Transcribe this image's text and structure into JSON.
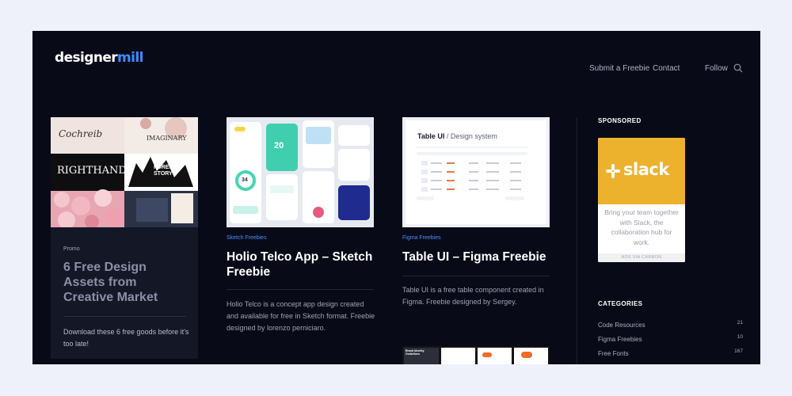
{
  "header": {
    "logo_main": "designer",
    "logo_accent": "mill",
    "nav": [
      "Submit a Freebie",
      "Contact",
      "Follow"
    ]
  },
  "promo": {
    "tag": "Promo",
    "title": "6 Free Design Assets from Creative Market",
    "description": "Download these 6 free goods before it's too late!",
    "thumb_texts": [
      "Cochreib",
      "IMAGINARY",
      "RIGHTHAND",
      "FOREST STORY"
    ]
  },
  "posts": [
    {
      "category": "Sketch Freebies",
      "title": "Holio Telco App – Sketch Freebie",
      "description": "Holio Telco is a concept app design created and available for free in Sketch format. Freebie designed by lorenzo perniciaro.",
      "thumb_numbers": [
        "20",
        "34"
      ]
    },
    {
      "category": "Figma Freebies",
      "title": "Table UI – Figma Freebie",
      "description": "Table UI is a free table component created in Figma. Freebie designed by Sergey.",
      "thumb_title": "Table UI",
      "thumb_subtitle": "/ Design system",
      "next_thumb_text": "Brand Identity Guidelines"
    }
  ],
  "sidebar": {
    "sponsored_heading": "SPONSORED",
    "ad_brand": "slack",
    "ad_text": "Bring your team together with Slack, the collaboration hub for work.",
    "ad_footer": "ADS VIA CARBON",
    "categories_heading": "CATEGORIES",
    "categories": [
      {
        "name": "Code Resources",
        "count": "21"
      },
      {
        "name": "Figma Freebies",
        "count": "10"
      },
      {
        "name": "Free Fonts",
        "count": "167"
      }
    ]
  },
  "colors": {
    "frame_bg": "#080a17",
    "page_bg": "#eef0fa",
    "accent": "#3d8bff",
    "slack_yellow": "#ecb22e"
  }
}
